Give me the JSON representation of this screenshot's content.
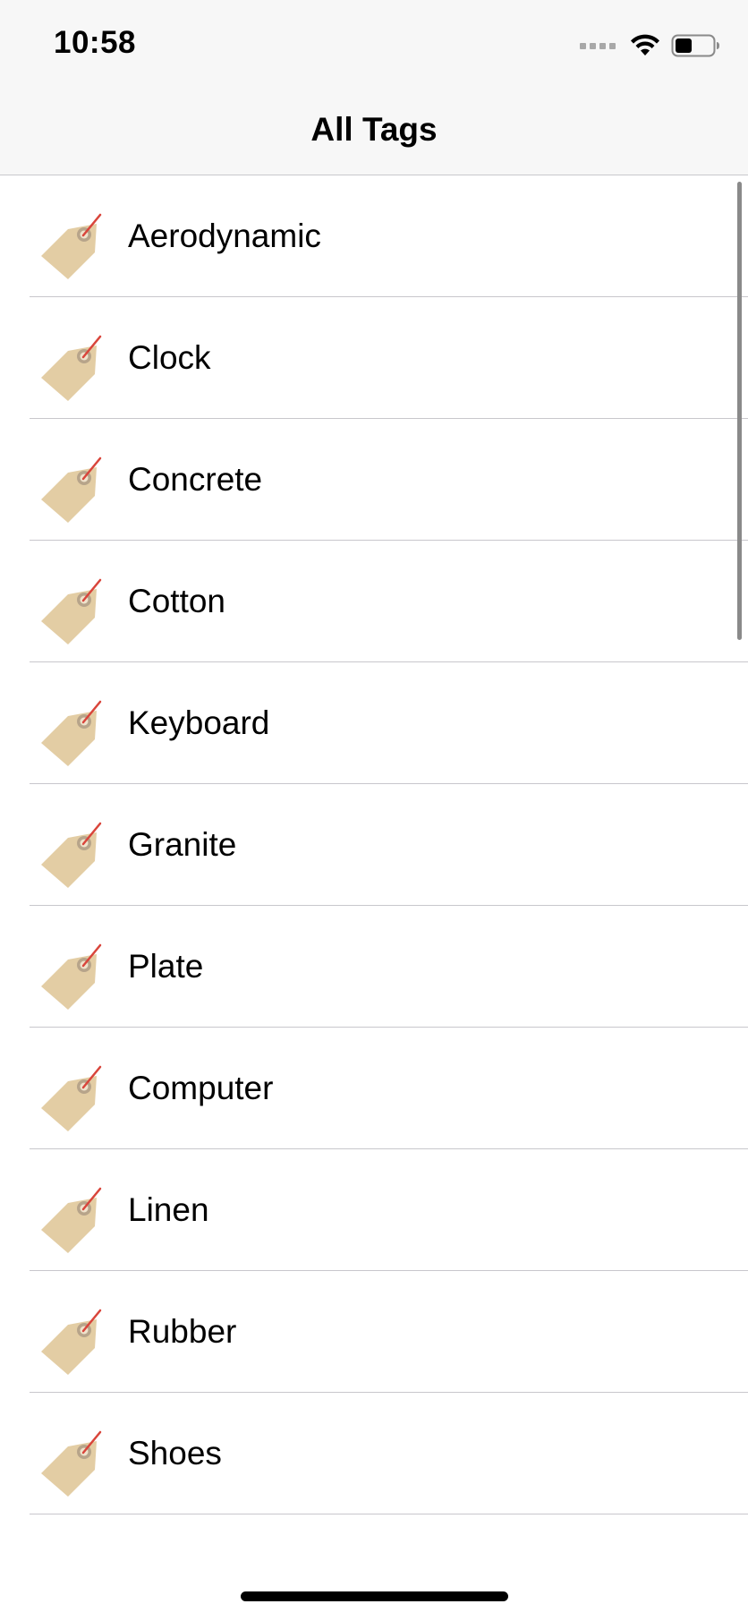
{
  "status_bar": {
    "time": "10:58",
    "signal_icon": "cellular-signal-dots-icon",
    "wifi_icon": "wifi-icon",
    "battery_icon": "battery-icon",
    "battery_level": 0.45
  },
  "nav": {
    "title": "All Tags"
  },
  "tags": [
    {
      "label": "Aerodynamic",
      "icon": "price-tag-icon"
    },
    {
      "label": "Clock",
      "icon": "price-tag-icon"
    },
    {
      "label": "Concrete",
      "icon": "price-tag-icon"
    },
    {
      "label": "Cotton",
      "icon": "price-tag-icon"
    },
    {
      "label": "Keyboard",
      "icon": "price-tag-icon"
    },
    {
      "label": "Granite",
      "icon": "price-tag-icon"
    },
    {
      "label": "Plate",
      "icon": "price-tag-icon"
    },
    {
      "label": "Computer",
      "icon": "price-tag-icon"
    },
    {
      "label": "Linen",
      "icon": "price-tag-icon"
    },
    {
      "label": "Rubber",
      "icon": "price-tag-icon"
    },
    {
      "label": "Shoes",
      "icon": "price-tag-icon"
    }
  ],
  "colors": {
    "chrome_background": "#f7f7f7",
    "separator": "#c8c7cc",
    "tag_body": "#e3cda4",
    "tag_string": "#d9453b",
    "tag_hole_ring": "#b7a48a"
  }
}
